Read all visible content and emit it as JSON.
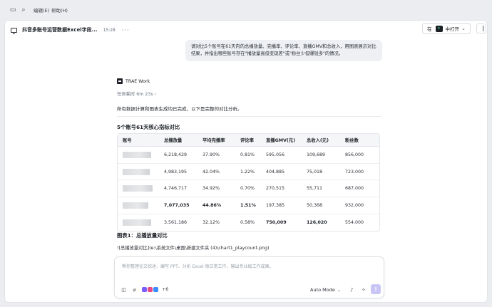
{
  "menu": {
    "edit": "编辑(E)",
    "help": "帮助(H)"
  },
  "header": {
    "title": "抖音多账号运营数据Excel字段...",
    "time": "15:28",
    "more": "···",
    "open_in_prefix": "在",
    "open_in_label": "中打开",
    "badge": "&gt;"
  },
  "conversation": {
    "user_message": "请对比5个账号在61天内的总播放量、完播率、评论率、直播GMV和总收入，用图表展示对比结果，并指出哪些账号存在\"播放量高但变现差\"或\"粉丝少但赚钱多\"的情况。",
    "assistant_name": "TRAE Work",
    "task_time": "任务耗时 6m 23s",
    "intro": "所有数据计算和图表生成均已完成，以下是完整的对比分析。",
    "table_heading": "5个账号61天核心指标对比",
    "chart_heading": "图表1：总播放量对比",
    "image_ref": "![总播放量对比](e:\\系统文件\\桌面\\新建文件夹 (4)\\chart1_playcount.png)"
  },
  "table": {
    "headers": [
      "账号",
      "总播放量",
      "平均完播率",
      "评论率",
      "直播GMV(元)",
      "总收入(元)",
      "粉丝数"
    ],
    "rows": [
      {
        "cells": [
          "6,218,429",
          "37.90%",
          "0.81%",
          "595,056",
          "109,689",
          "856,000"
        ],
        "bold": [
          false,
          false,
          false,
          false,
          false,
          false
        ]
      },
      {
        "cells": [
          "4,983,195",
          "42.04%",
          "1.22%",
          "404,885",
          "75,018",
          "723,000"
        ],
        "bold": [
          false,
          false,
          false,
          false,
          false,
          false
        ]
      },
      {
        "cells": [
          "4,746,717",
          "34.92%",
          "0.70%",
          "270,515",
          "55,711",
          "687,000"
        ],
        "bold": [
          false,
          false,
          false,
          false,
          false,
          false
        ]
      },
      {
        "cells": [
          "7,077,035",
          "44.86%",
          "1.51%",
          "197,385",
          "50,368",
          "932,000"
        ],
        "bold": [
          true,
          true,
          true,
          false,
          false,
          false
        ]
      },
      {
        "cells": [
          "3,561,186",
          "32.12%",
          "0.58%",
          "750,009",
          "126,020",
          "554,000"
        ],
        "bold": [
          false,
          false,
          false,
          true,
          true,
          false
        ]
      }
    ]
  },
  "composer": {
    "placeholder": "帮你整理论文综述、编写 PPT、分析 Excel 每日常工作，输出专业级工作成果。",
    "extra_count": "+6",
    "mode": "Auto Mode",
    "mode_chevron": "⌄"
  },
  "colors": {
    "accent": "#c9c6f5",
    "chip1": "#7b5cff",
    "chip2": "#e44b86",
    "chip3": "#3a8dff"
  }
}
